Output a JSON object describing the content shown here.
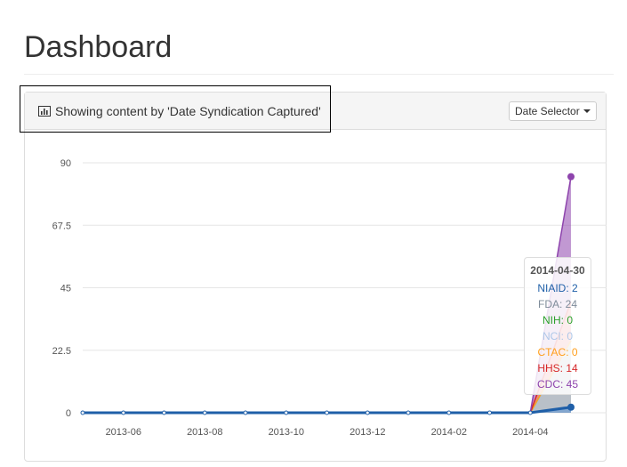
{
  "page": {
    "title": "Dashboard"
  },
  "panel": {
    "heading_text": "Showing content by 'Date Syndication Captured'",
    "heading_icon": "bar-chart-icon",
    "date_selector_label": "Date Selector"
  },
  "chart_data": {
    "type": "area",
    "x": [
      "2013-05",
      "2013-06",
      "2013-07",
      "2013-08",
      "2013-09",
      "2013-10",
      "2013-11",
      "2013-12",
      "2014-01",
      "2014-02",
      "2014-03",
      "2014-04",
      "2014-04-30"
    ],
    "x_tick_labels": [
      "2013-06",
      "2013-08",
      "2013-10",
      "2013-12",
      "2014-02",
      "2014-04"
    ],
    "y_ticks": [
      0,
      22.5,
      45,
      67.5,
      90
    ],
    "ylim": [
      0,
      90
    ],
    "grid": true,
    "stacked": true,
    "series": [
      {
        "name": "NIAID",
        "color": "#1f5fa8",
        "values": [
          0,
          0,
          0,
          0,
          0,
          0,
          0,
          0,
          0,
          0,
          0,
          0,
          2
        ]
      },
      {
        "name": "FDA",
        "color": "#7f8c9a",
        "values": [
          0,
          0,
          0,
          0,
          0,
          0,
          0,
          0,
          0,
          0,
          0,
          0,
          24
        ]
      },
      {
        "name": "NIH",
        "color": "#2ca02c",
        "values": [
          0,
          0,
          0,
          0,
          0,
          0,
          0,
          0,
          0,
          0,
          0,
          0,
          0
        ]
      },
      {
        "name": "NCI",
        "color": "#aec7e8",
        "values": [
          0,
          0,
          0,
          0,
          0,
          0,
          0,
          0,
          0,
          0,
          0,
          0,
          0
        ]
      },
      {
        "name": "CTAC",
        "color": "#ff9f1c",
        "values": [
          0,
          0,
          0,
          0,
          0,
          0,
          0,
          0,
          0,
          0,
          0,
          0,
          0
        ]
      },
      {
        "name": "HHS",
        "color": "#d62728",
        "values": [
          0,
          0,
          0,
          0,
          0,
          0,
          0,
          0,
          0,
          0,
          0,
          0,
          14
        ]
      },
      {
        "name": "CDC",
        "color": "#8e44ad",
        "values": [
          0,
          0,
          0,
          0,
          0,
          0,
          0,
          0,
          0,
          0,
          0,
          0,
          45
        ]
      }
    ]
  },
  "tooltip": {
    "date": "2014-04-30",
    "rows": [
      {
        "text": "NIAID: 2",
        "color": "#1f5fa8"
      },
      {
        "text": "FDA: 24",
        "color": "#7f8c9a"
      },
      {
        "text": "NIH: 0",
        "color": "#2ca02c"
      },
      {
        "text": "NCI: 0",
        "color": "#aec7e8"
      },
      {
        "text": "CTAC: 0",
        "color": "#ff9f1c"
      },
      {
        "text": "HHS: 14",
        "color": "#d62728"
      },
      {
        "text": "CDC: 45",
        "color": "#8e44ad"
      }
    ]
  }
}
